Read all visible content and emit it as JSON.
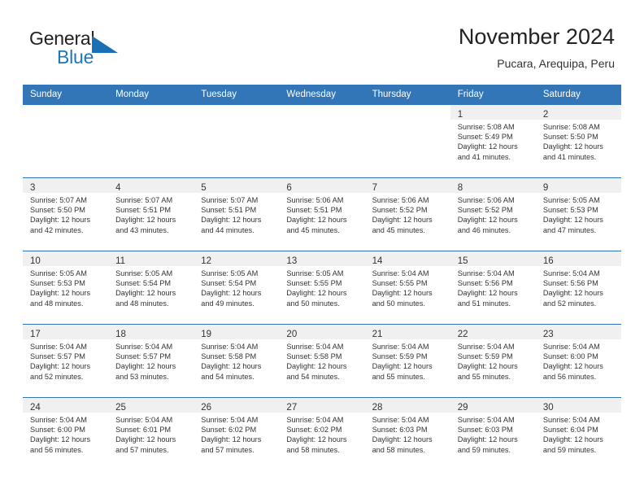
{
  "brand": {
    "word1": "General",
    "word2": "Blue",
    "logo_icon": "blue-triangle-logo",
    "accent_color": "#1b6fb5"
  },
  "header": {
    "title": "November 2024",
    "subtitle": "Pucara, Arequipa, Peru"
  },
  "theme": {
    "header_blue": "#3276b8",
    "daynum_band": "#f0f0f0",
    "text": "#333333"
  },
  "calendar": {
    "weekday_headers": [
      "Sunday",
      "Monday",
      "Tuesday",
      "Wednesday",
      "Thursday",
      "Friday",
      "Saturday"
    ],
    "weeks": [
      [
        {
          "day": "",
          "lines": []
        },
        {
          "day": "",
          "lines": []
        },
        {
          "day": "",
          "lines": []
        },
        {
          "day": "",
          "lines": []
        },
        {
          "day": "",
          "lines": []
        },
        {
          "day": "1",
          "lines": [
            "Sunrise: 5:08 AM",
            "Sunset: 5:49 PM",
            "Daylight: 12 hours",
            "and 41 minutes."
          ]
        },
        {
          "day": "2",
          "lines": [
            "Sunrise: 5:08 AM",
            "Sunset: 5:50 PM",
            "Daylight: 12 hours",
            "and 41 minutes."
          ]
        }
      ],
      [
        {
          "day": "3",
          "lines": [
            "Sunrise: 5:07 AM",
            "Sunset: 5:50 PM",
            "Daylight: 12 hours",
            "and 42 minutes."
          ]
        },
        {
          "day": "4",
          "lines": [
            "Sunrise: 5:07 AM",
            "Sunset: 5:51 PM",
            "Daylight: 12 hours",
            "and 43 minutes."
          ]
        },
        {
          "day": "5",
          "lines": [
            "Sunrise: 5:07 AM",
            "Sunset: 5:51 PM",
            "Daylight: 12 hours",
            "and 44 minutes."
          ]
        },
        {
          "day": "6",
          "lines": [
            "Sunrise: 5:06 AM",
            "Sunset: 5:51 PM",
            "Daylight: 12 hours",
            "and 45 minutes."
          ]
        },
        {
          "day": "7",
          "lines": [
            "Sunrise: 5:06 AM",
            "Sunset: 5:52 PM",
            "Daylight: 12 hours",
            "and 45 minutes."
          ]
        },
        {
          "day": "8",
          "lines": [
            "Sunrise: 5:06 AM",
            "Sunset: 5:52 PM",
            "Daylight: 12 hours",
            "and 46 minutes."
          ]
        },
        {
          "day": "9",
          "lines": [
            "Sunrise: 5:05 AM",
            "Sunset: 5:53 PM",
            "Daylight: 12 hours",
            "and 47 minutes."
          ]
        }
      ],
      [
        {
          "day": "10",
          "lines": [
            "Sunrise: 5:05 AM",
            "Sunset: 5:53 PM",
            "Daylight: 12 hours",
            "and 48 minutes."
          ]
        },
        {
          "day": "11",
          "lines": [
            "Sunrise: 5:05 AM",
            "Sunset: 5:54 PM",
            "Daylight: 12 hours",
            "and 48 minutes."
          ]
        },
        {
          "day": "12",
          "lines": [
            "Sunrise: 5:05 AM",
            "Sunset: 5:54 PM",
            "Daylight: 12 hours",
            "and 49 minutes."
          ]
        },
        {
          "day": "13",
          "lines": [
            "Sunrise: 5:05 AM",
            "Sunset: 5:55 PM",
            "Daylight: 12 hours",
            "and 50 minutes."
          ]
        },
        {
          "day": "14",
          "lines": [
            "Sunrise: 5:04 AM",
            "Sunset: 5:55 PM",
            "Daylight: 12 hours",
            "and 50 minutes."
          ]
        },
        {
          "day": "15",
          "lines": [
            "Sunrise: 5:04 AM",
            "Sunset: 5:56 PM",
            "Daylight: 12 hours",
            "and 51 minutes."
          ]
        },
        {
          "day": "16",
          "lines": [
            "Sunrise: 5:04 AM",
            "Sunset: 5:56 PM",
            "Daylight: 12 hours",
            "and 52 minutes."
          ]
        }
      ],
      [
        {
          "day": "17",
          "lines": [
            "Sunrise: 5:04 AM",
            "Sunset: 5:57 PM",
            "Daylight: 12 hours",
            "and 52 minutes."
          ]
        },
        {
          "day": "18",
          "lines": [
            "Sunrise: 5:04 AM",
            "Sunset: 5:57 PM",
            "Daylight: 12 hours",
            "and 53 minutes."
          ]
        },
        {
          "day": "19",
          "lines": [
            "Sunrise: 5:04 AM",
            "Sunset: 5:58 PM",
            "Daylight: 12 hours",
            "and 54 minutes."
          ]
        },
        {
          "day": "20",
          "lines": [
            "Sunrise: 5:04 AM",
            "Sunset: 5:58 PM",
            "Daylight: 12 hours",
            "and 54 minutes."
          ]
        },
        {
          "day": "21",
          "lines": [
            "Sunrise: 5:04 AM",
            "Sunset: 5:59 PM",
            "Daylight: 12 hours",
            "and 55 minutes."
          ]
        },
        {
          "day": "22",
          "lines": [
            "Sunrise: 5:04 AM",
            "Sunset: 5:59 PM",
            "Daylight: 12 hours",
            "and 55 minutes."
          ]
        },
        {
          "day": "23",
          "lines": [
            "Sunrise: 5:04 AM",
            "Sunset: 6:00 PM",
            "Daylight: 12 hours",
            "and 56 minutes."
          ]
        }
      ],
      [
        {
          "day": "24",
          "lines": [
            "Sunrise: 5:04 AM",
            "Sunset: 6:00 PM",
            "Daylight: 12 hours",
            "and 56 minutes."
          ]
        },
        {
          "day": "25",
          "lines": [
            "Sunrise: 5:04 AM",
            "Sunset: 6:01 PM",
            "Daylight: 12 hours",
            "and 57 minutes."
          ]
        },
        {
          "day": "26",
          "lines": [
            "Sunrise: 5:04 AM",
            "Sunset: 6:02 PM",
            "Daylight: 12 hours",
            "and 57 minutes."
          ]
        },
        {
          "day": "27",
          "lines": [
            "Sunrise: 5:04 AM",
            "Sunset: 6:02 PM",
            "Daylight: 12 hours",
            "and 58 minutes."
          ]
        },
        {
          "day": "28",
          "lines": [
            "Sunrise: 5:04 AM",
            "Sunset: 6:03 PM",
            "Daylight: 12 hours",
            "and 58 minutes."
          ]
        },
        {
          "day": "29",
          "lines": [
            "Sunrise: 5:04 AM",
            "Sunset: 6:03 PM",
            "Daylight: 12 hours",
            "and 59 minutes."
          ]
        },
        {
          "day": "30",
          "lines": [
            "Sunrise: 5:04 AM",
            "Sunset: 6:04 PM",
            "Daylight: 12 hours",
            "and 59 minutes."
          ]
        }
      ]
    ]
  }
}
